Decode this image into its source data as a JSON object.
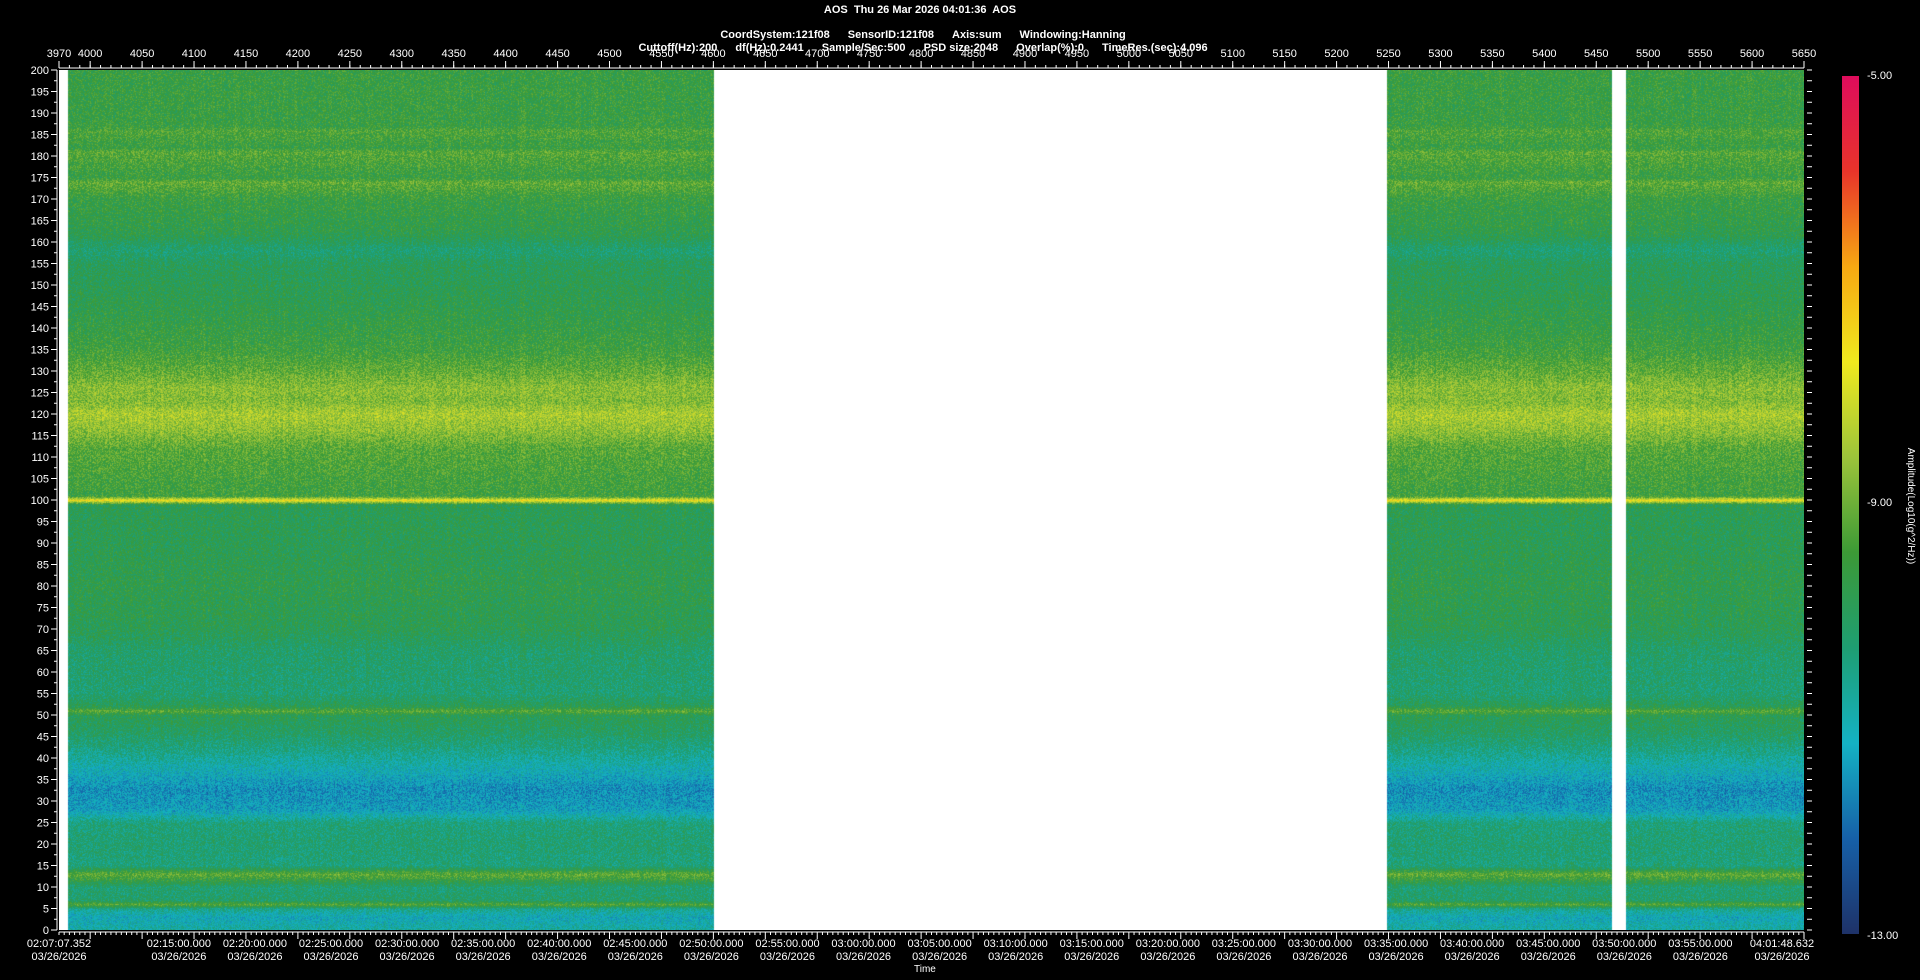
{
  "header": {
    "line1": "AOS  Thu 26 Mar 2026 04:01:36  AOS",
    "line2": [
      "CoordSystem:121f08",
      "SensorID:121f08",
      "Axis:sum",
      "Windowing:Hanning"
    ],
    "line3": [
      "Cuttoff(Hz):200",
      "df(Hz):0.2441",
      "Sample/Sec:500",
      "PSD size:2048",
      "Overlap(%):0",
      "TimeRes.(sec):4.096"
    ]
  },
  "colorbar": {
    "title": "Amplitude(Log10(g^2/Hz))",
    "max_label": "-5.00",
    "mid_label": "-9.00",
    "min_label": "-13.00",
    "range": [
      -13,
      -5
    ],
    "stops": [
      "#1e3268",
      "#1660a8",
      "#14b2c4",
      "#1e9e72",
      "#3c9a36",
      "#9cc43a",
      "#f0ea1e",
      "#f7a812",
      "#e8342a",
      "#de0c5c"
    ]
  },
  "chart_data": {
    "type": "heatmap",
    "title": "AOS  Thu 26 Mar 2026 04:01:36  AOS",
    "xlabel": "Time",
    "ylabel": "",
    "top_axis": {
      "range": [
        3970,
        5650
      ],
      "ticks": [
        3970,
        4000,
        4050,
        4100,
        4150,
        4200,
        4250,
        4300,
        4350,
        4400,
        4450,
        4500,
        4550,
        4600,
        4650,
        4700,
        4750,
        4800,
        4850,
        4900,
        4950,
        5000,
        5050,
        5100,
        5150,
        5200,
        5250,
        5300,
        5350,
        5400,
        5450,
        5500,
        5550,
        5600,
        5650
      ]
    },
    "y_axis": {
      "range": [
        0,
        200
      ],
      "step": 5
    },
    "bottom_axis": {
      "start": "02:07:07.352",
      "seconds_per_sample": 4.096,
      "labels": [
        {
          "time": "02:07:07.352",
          "date": "03/26/2026"
        },
        {
          "time": "02:15:00.000",
          "date": "03/26/2026"
        },
        {
          "time": "02:20:00.000",
          "date": "03/26/2026"
        },
        {
          "time": "02:25:00.000",
          "date": "03/26/2026"
        },
        {
          "time": "02:30:00.000",
          "date": "03/26/2026"
        },
        {
          "time": "02:35:00.000",
          "date": "03/26/2026"
        },
        {
          "time": "02:40:00.000",
          "date": "03/26/2026"
        },
        {
          "time": "02:45:00.000",
          "date": "03/26/2026"
        },
        {
          "time": "02:50:00.000",
          "date": "03/26/2026"
        },
        {
          "time": "02:55:00.000",
          "date": "03/26/2026"
        },
        {
          "time": "03:00:00.000",
          "date": "03/26/2026"
        },
        {
          "time": "03:05:00.000",
          "date": "03/26/2026"
        },
        {
          "time": "03:10:00.000",
          "date": "03/26/2026"
        },
        {
          "time": "03:15:00.000",
          "date": "03/26/2026"
        },
        {
          "time": "03:20:00.000",
          "date": "03/26/2026"
        },
        {
          "time": "03:25:00.000",
          "date": "03/26/2026"
        },
        {
          "time": "03:30:00.000",
          "date": "03/26/2026"
        },
        {
          "time": "03:35:00.000",
          "date": "03/26/2026"
        },
        {
          "time": "03:40:00.000",
          "date": "03/26/2026"
        },
        {
          "time": "03:45:00.000",
          "date": "03/26/2026"
        },
        {
          "time": "03:50:00.000",
          "date": "03/26/2026"
        },
        {
          "time": "03:55:00.000",
          "date": "03/26/2026"
        },
        {
          "time": "04:01:48.632",
          "date": "03/26/2026"
        }
      ]
    },
    "data_gaps": [
      [
        3970,
        3978
      ],
      [
        4600,
        5248
      ],
      [
        5465,
        5478
      ]
    ],
    "frequency_profile": [
      [
        0,
        -10.8
      ],
      [
        3,
        -11.2
      ],
      [
        5,
        -10.6
      ],
      [
        6,
        -9.2
      ],
      [
        7,
        -10.2
      ],
      [
        10,
        -10.3
      ],
      [
        13,
        -9.1
      ],
      [
        15,
        -10.4
      ],
      [
        20,
        -10.3
      ],
      [
        25,
        -10.4
      ],
      [
        28,
        -11.4
      ],
      [
        33,
        -11.6
      ],
      [
        38,
        -11.0
      ],
      [
        42,
        -10.5
      ],
      [
        46,
        -10.1
      ],
      [
        50,
        -9.9
      ],
      [
        51,
        -9.2
      ],
      [
        52,
        -9.9
      ],
      [
        55,
        -10.3
      ],
      [
        65,
        -10.2
      ],
      [
        70,
        -9.9
      ],
      [
        80,
        -9.8
      ],
      [
        90,
        -9.9
      ],
      [
        99,
        -9.9
      ],
      [
        100,
        -7.6
      ],
      [
        101,
        -9.5
      ],
      [
        105,
        -9.4
      ],
      [
        112,
        -9.2
      ],
      [
        116,
        -8.7
      ],
      [
        120,
        -8.4
      ],
      [
        123,
        -8.8
      ],
      [
        126,
        -8.7
      ],
      [
        130,
        -9.1
      ],
      [
        135,
        -9.5
      ],
      [
        145,
        -9.8
      ],
      [
        155,
        -10.0
      ],
      [
        158,
        -10.3
      ],
      [
        162,
        -9.8
      ],
      [
        170,
        -9.6
      ],
      [
        174,
        -9.1
      ],
      [
        175,
        -9.6
      ],
      [
        181,
        -9.2
      ],
      [
        182,
        -9.6
      ],
      [
        186,
        -9.3
      ],
      [
        187,
        -9.6
      ],
      [
        200,
        -9.6
      ]
    ]
  }
}
